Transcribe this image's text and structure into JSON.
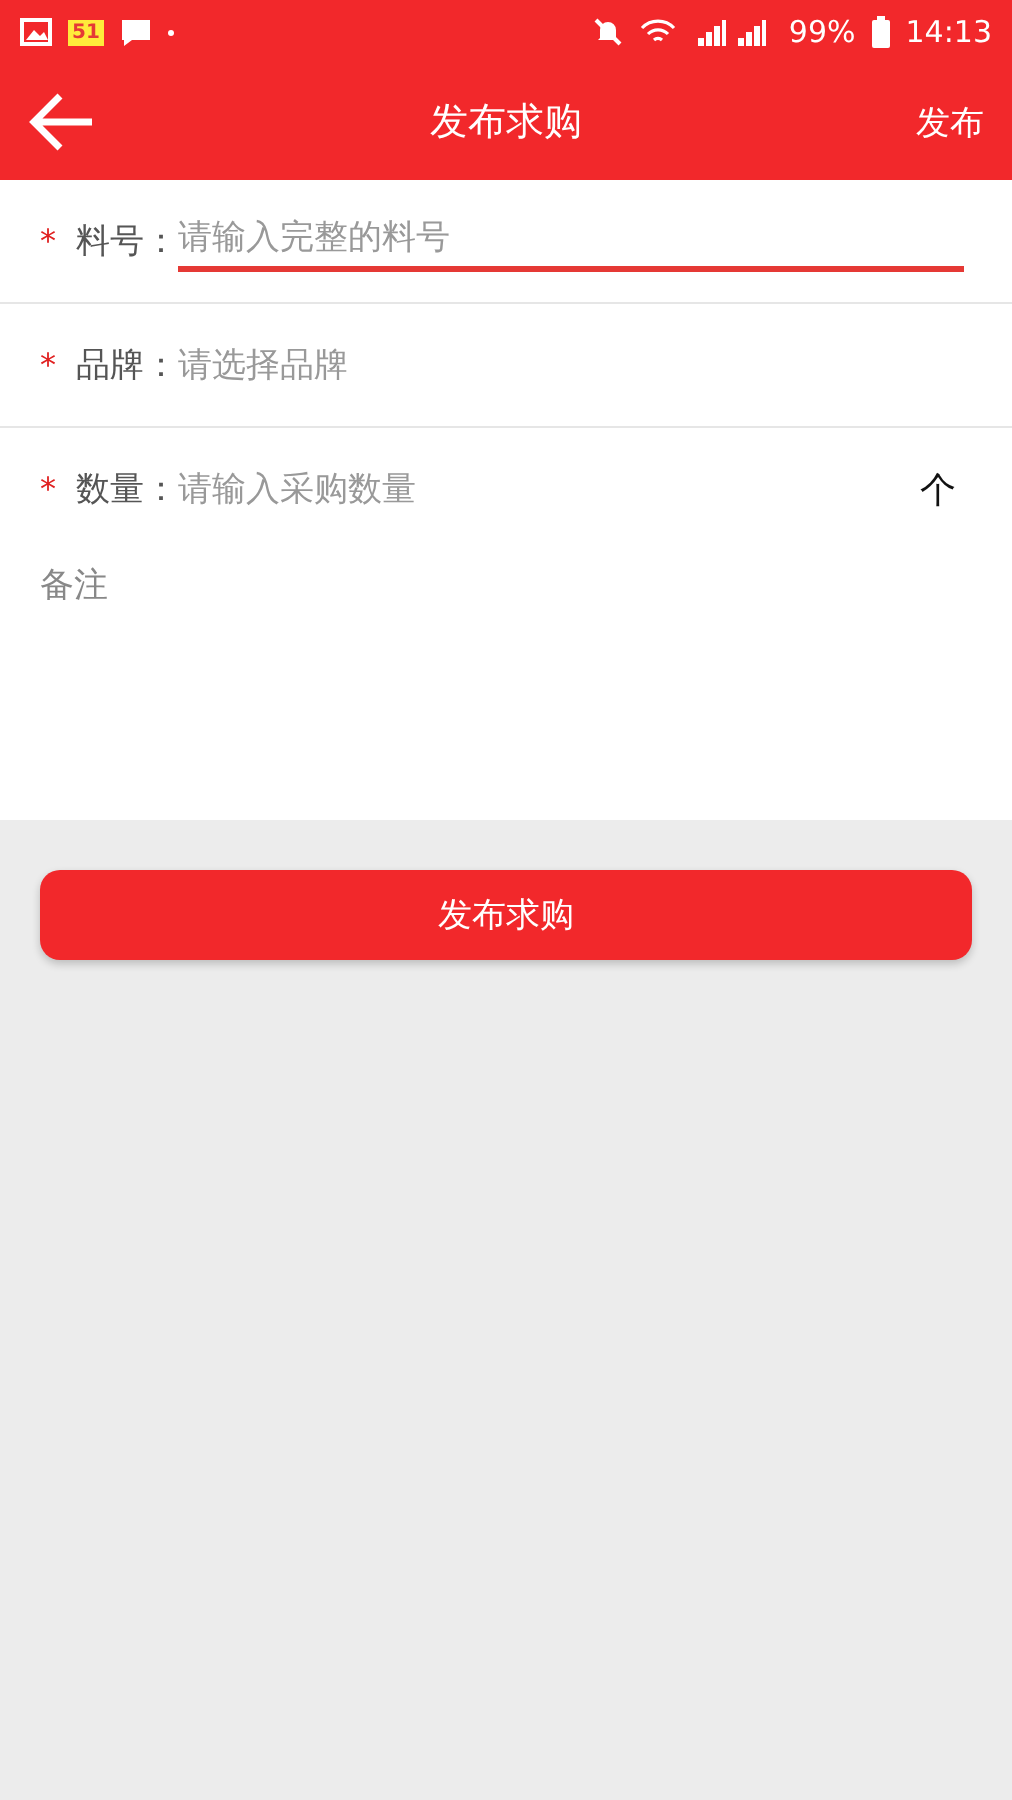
{
  "status_bar": {
    "app_badge": "51",
    "battery": "99%",
    "time": "14:13"
  },
  "header": {
    "title": "发布求购",
    "action": "发布"
  },
  "fields": [
    {
      "kind": "input",
      "required_mark": "*",
      "label": "料号：",
      "placeholder": "请输入完整的料号",
      "focused": true
    },
    {
      "kind": "select",
      "required_mark": "*",
      "label": "品牌：",
      "placeholder": "请选择品牌",
      "focused": false
    },
    {
      "kind": "input",
      "required_mark": "*",
      "label": "数量：",
      "placeholder": "请输入采购数量",
      "unit": "个",
      "focused": false
    }
  ],
  "remark": {
    "placeholder": "备注"
  },
  "submit_button": "发布求购"
}
